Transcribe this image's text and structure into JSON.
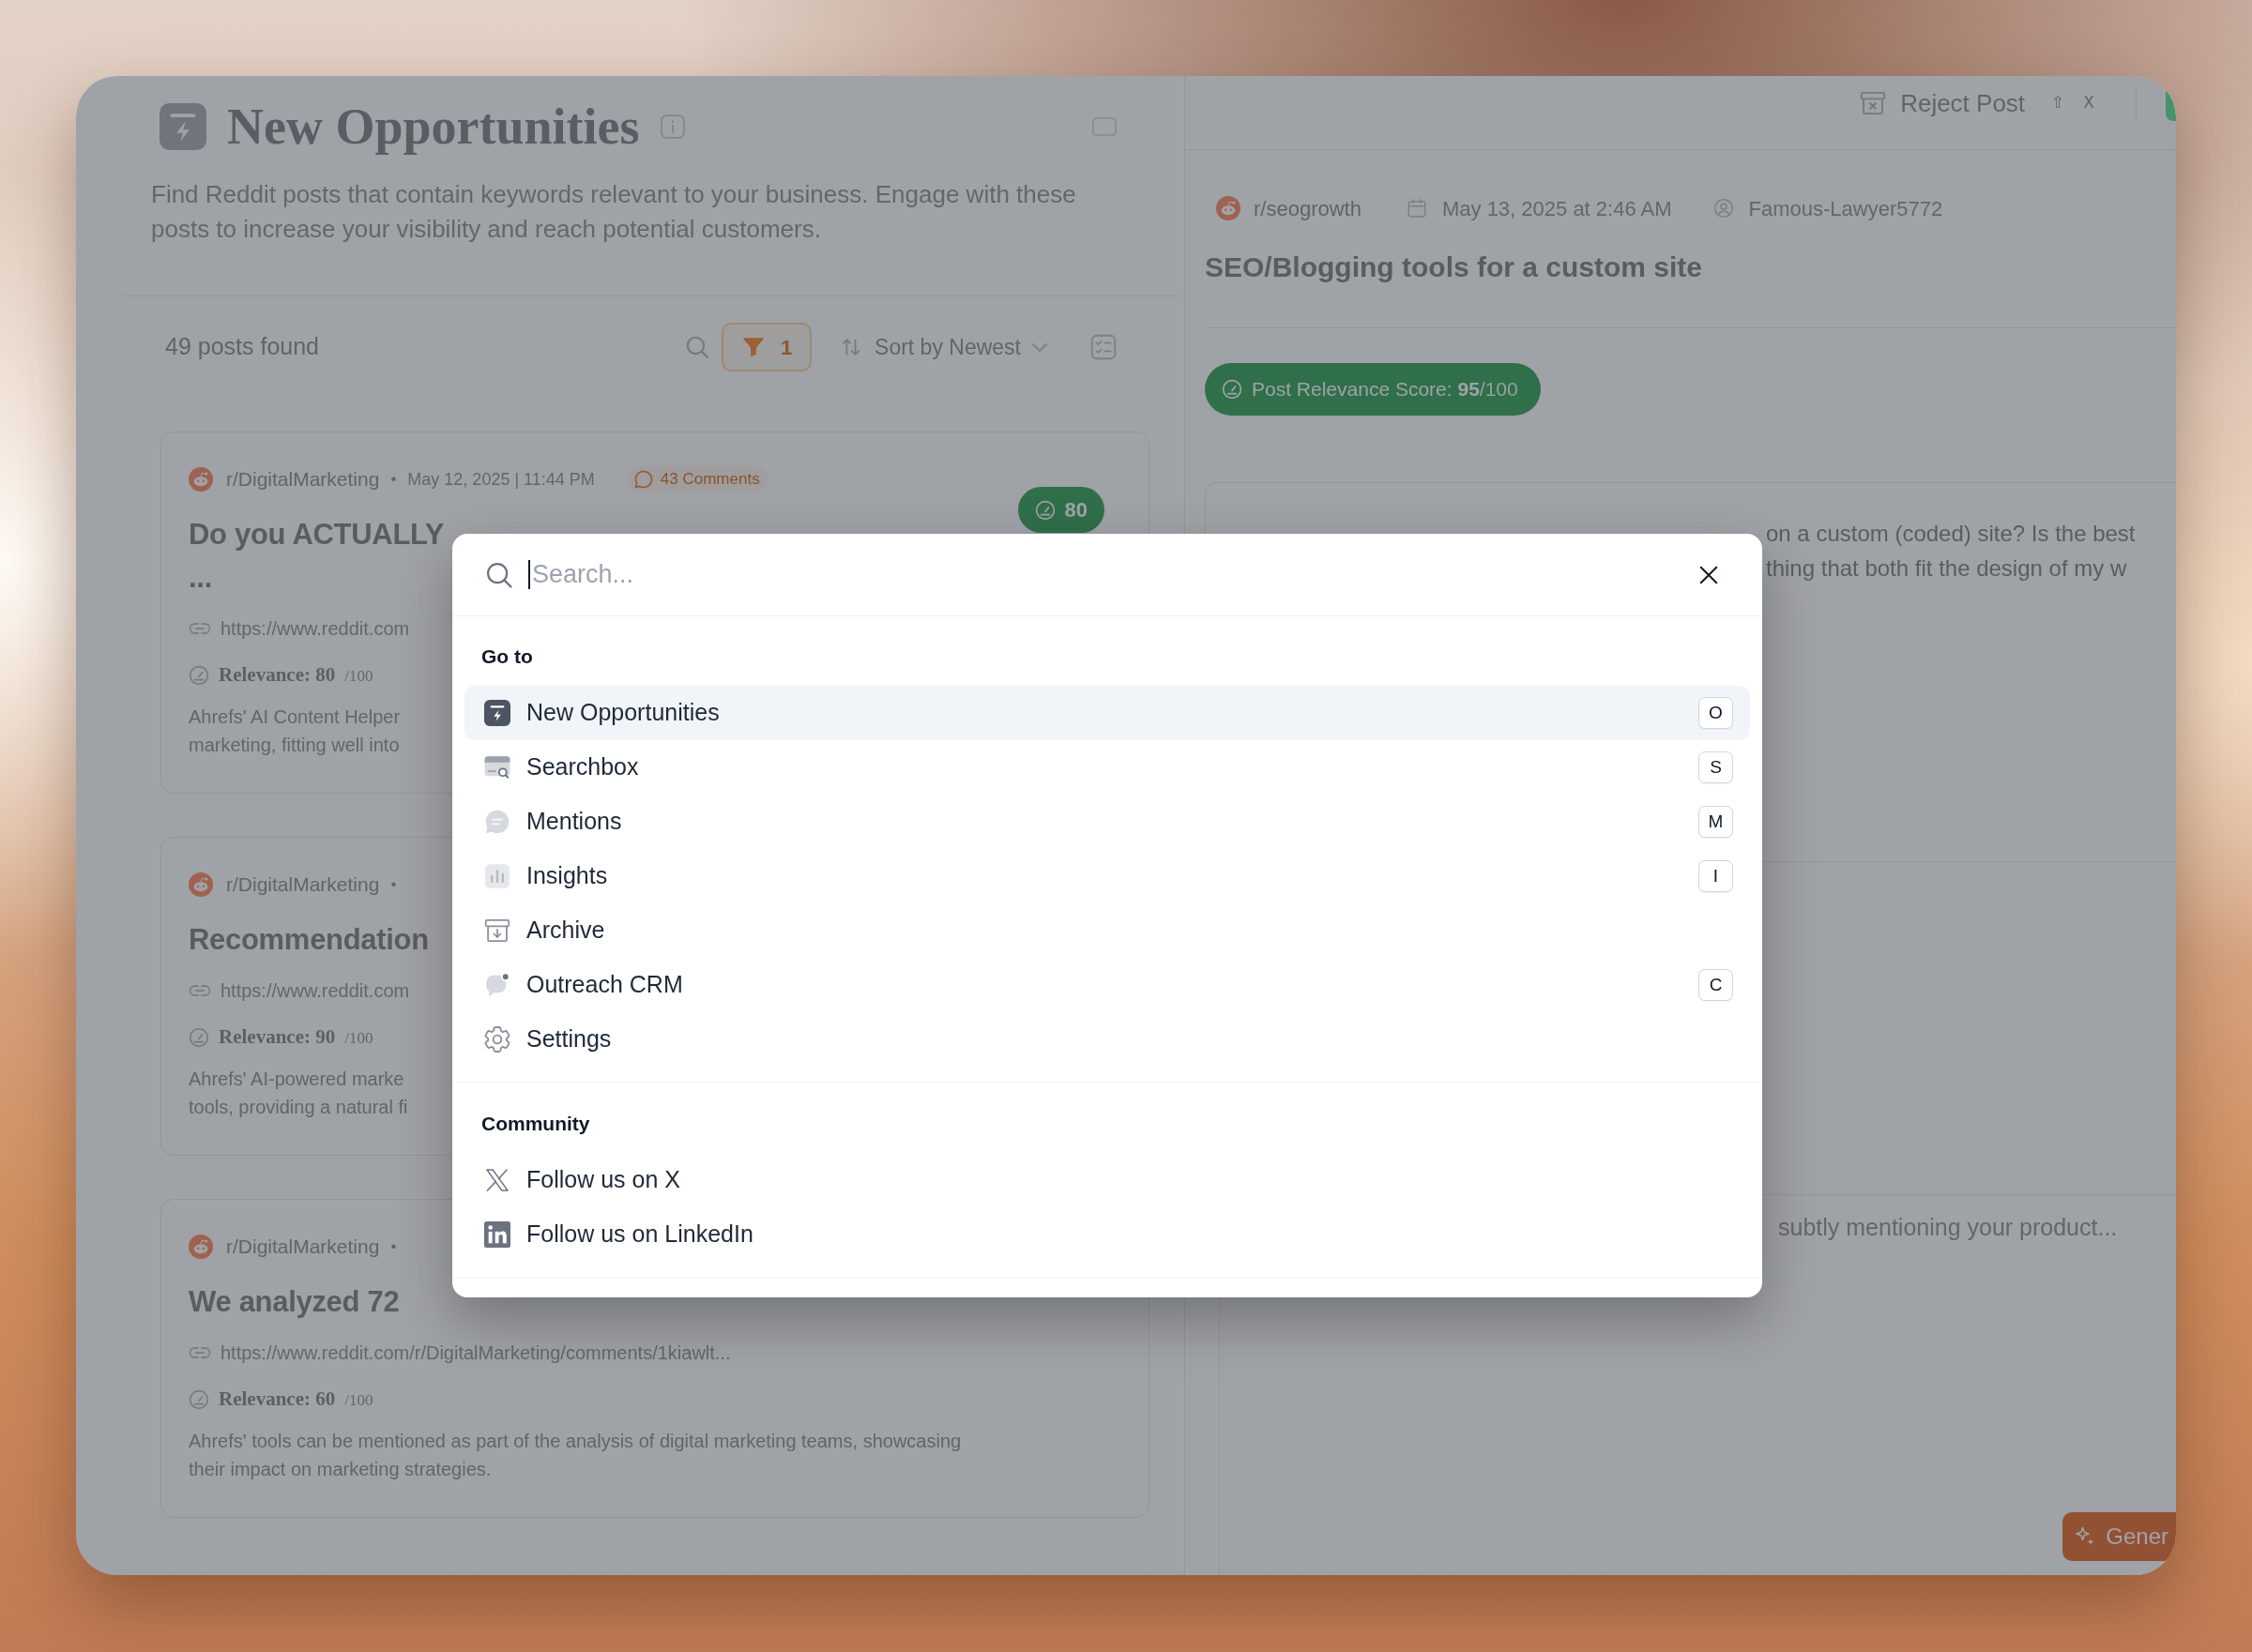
{
  "app": {
    "header": {
      "title": "New Opportunities",
      "description": "Find Reddit posts that contain keywords relevant to your business. Engage with these posts to increase your visibility and reach potential customers."
    },
    "toolbar": {
      "results": "49 posts found",
      "filter_count": "1",
      "sort": "Sort by Newest"
    },
    "posts": [
      {
        "subreddit": "r/DigitalMarketing",
        "separator": "•",
        "date": "May 12, 2025 | 11:44 PM",
        "comments": "43 Comments",
        "score": "80",
        "title": "Do you ACTUALLY\n...",
        "link": "https://www.reddit.com",
        "relevance": "Relevance: 80",
        "relevance_max": "/100",
        "summary": "Ahrefs' AI Content Helper\nmarketing, fitting well into"
      },
      {
        "subreddit": "r/DigitalMarketing",
        "separator": "•",
        "title": "Recommendation",
        "link": "https://www.reddit.com",
        "relevance": "Relevance: 90",
        "relevance_max": "/100",
        "summary": "Ahrefs' AI-powered marke\ntools, providing a natural fi"
      },
      {
        "subreddit": "r/DigitalMarketing",
        "separator": "•",
        "title": "We analyzed 72",
        "link": "https://www.reddit.com/r/DigitalMarketing/comments/1kiawlt...",
        "relevance": "Relevance: 60",
        "relevance_max": "/100",
        "summary": "Ahrefs' tools can be mentioned as part of the analysis of digital marketing teams, showcasing their impact on marketing strategies."
      }
    ]
  },
  "detail": {
    "toolbar": {
      "reject": "Reject Post",
      "shortcut": [
        "⇧",
        "X"
      ]
    },
    "post": {
      "subreddit": "r/seogrowth",
      "date": "May 13, 2025 at 2:46 AM",
      "author": "Famous-Lawyer5772",
      "title": "SEO/Blogging tools for a custom site",
      "score_label": "Post Relevance Score: **95**",
      "score_max": "/100",
      "body": "on a custom (coded) site? Is the best\nthing that both fit the design of my w"
    },
    "reply": {
      "placeholder": "subtly mentioning your product...",
      "generate": "Gener"
    }
  },
  "command_palette": {
    "search": {
      "placeholder": "Search..."
    },
    "sections": [
      {
        "label": "Go to",
        "items": [
          {
            "label": "New Opportunities",
            "kind": "opportunities",
            "shortcut": "O",
            "selected": true
          },
          {
            "label": "Searchbox",
            "kind": "searchbox",
            "shortcut": "S",
            "selected": false
          },
          {
            "label": "Mentions",
            "kind": "mentions",
            "shortcut": "M",
            "selected": false
          },
          {
            "label": "Insights",
            "kind": "insights",
            "shortcut": "I",
            "selected": false
          },
          {
            "label": "Archive",
            "kind": "archive",
            "selected": false
          },
          {
            "label": "Outreach CRM",
            "kind": "crm",
            "shortcut": "C",
            "selected": false
          },
          {
            "label": "Settings",
            "kind": "settings",
            "selected": false
          }
        ]
      },
      {
        "label": "Community",
        "items": [
          {
            "label": "Follow us on X",
            "kind": "x",
            "selected": false
          },
          {
            "label": "Follow us on LinkedIn",
            "kind": "linkedin",
            "selected": false
          }
        ]
      }
    ]
  }
}
